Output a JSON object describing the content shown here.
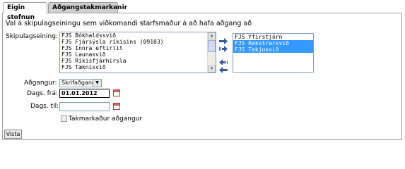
{
  "tabs": [
    {
      "label": "Eigin stofnun"
    },
    {
      "label": "Aðgangstakmarkanir"
    }
  ],
  "instruction": "Val á skipulagseiningu sem viðkomandi starfsmaður á að hafa aðgang að",
  "unit_label": "Skipulagseining:",
  "available_units": [
    "FJS Bókhaldssvið",
    "FJS Fjársýsla ríkisins (09103)",
    "FJS Innra eftirlit",
    "FJS Launasvið",
    "FJS Ríkisfjárhirsla",
    "FJS Tæknisvið"
  ],
  "selected_units": [
    {
      "label": "FJS Yfirstjórn",
      "highlighted": false
    },
    {
      "label": "FJS Rekstrarsvið",
      "highlighted": true
    },
    {
      "label": "FJS Tekjusvið",
      "highlighted": true
    }
  ],
  "access": {
    "label": "Aðgangur:",
    "value": "Skrifaðgangur"
  },
  "date_from": {
    "label": "Dags. frá:",
    "value": "01.01.2012"
  },
  "date_to": {
    "label": "Dags. til:",
    "value": ""
  },
  "restricted": {
    "label": "Takmarkaður aðgangur",
    "checked": false
  },
  "submit": {
    "label": "Vista"
  },
  "colors": {
    "selection": "#3399ff",
    "arrow": "#3a5aa0",
    "tab_inactive": "#cfcfcf"
  }
}
